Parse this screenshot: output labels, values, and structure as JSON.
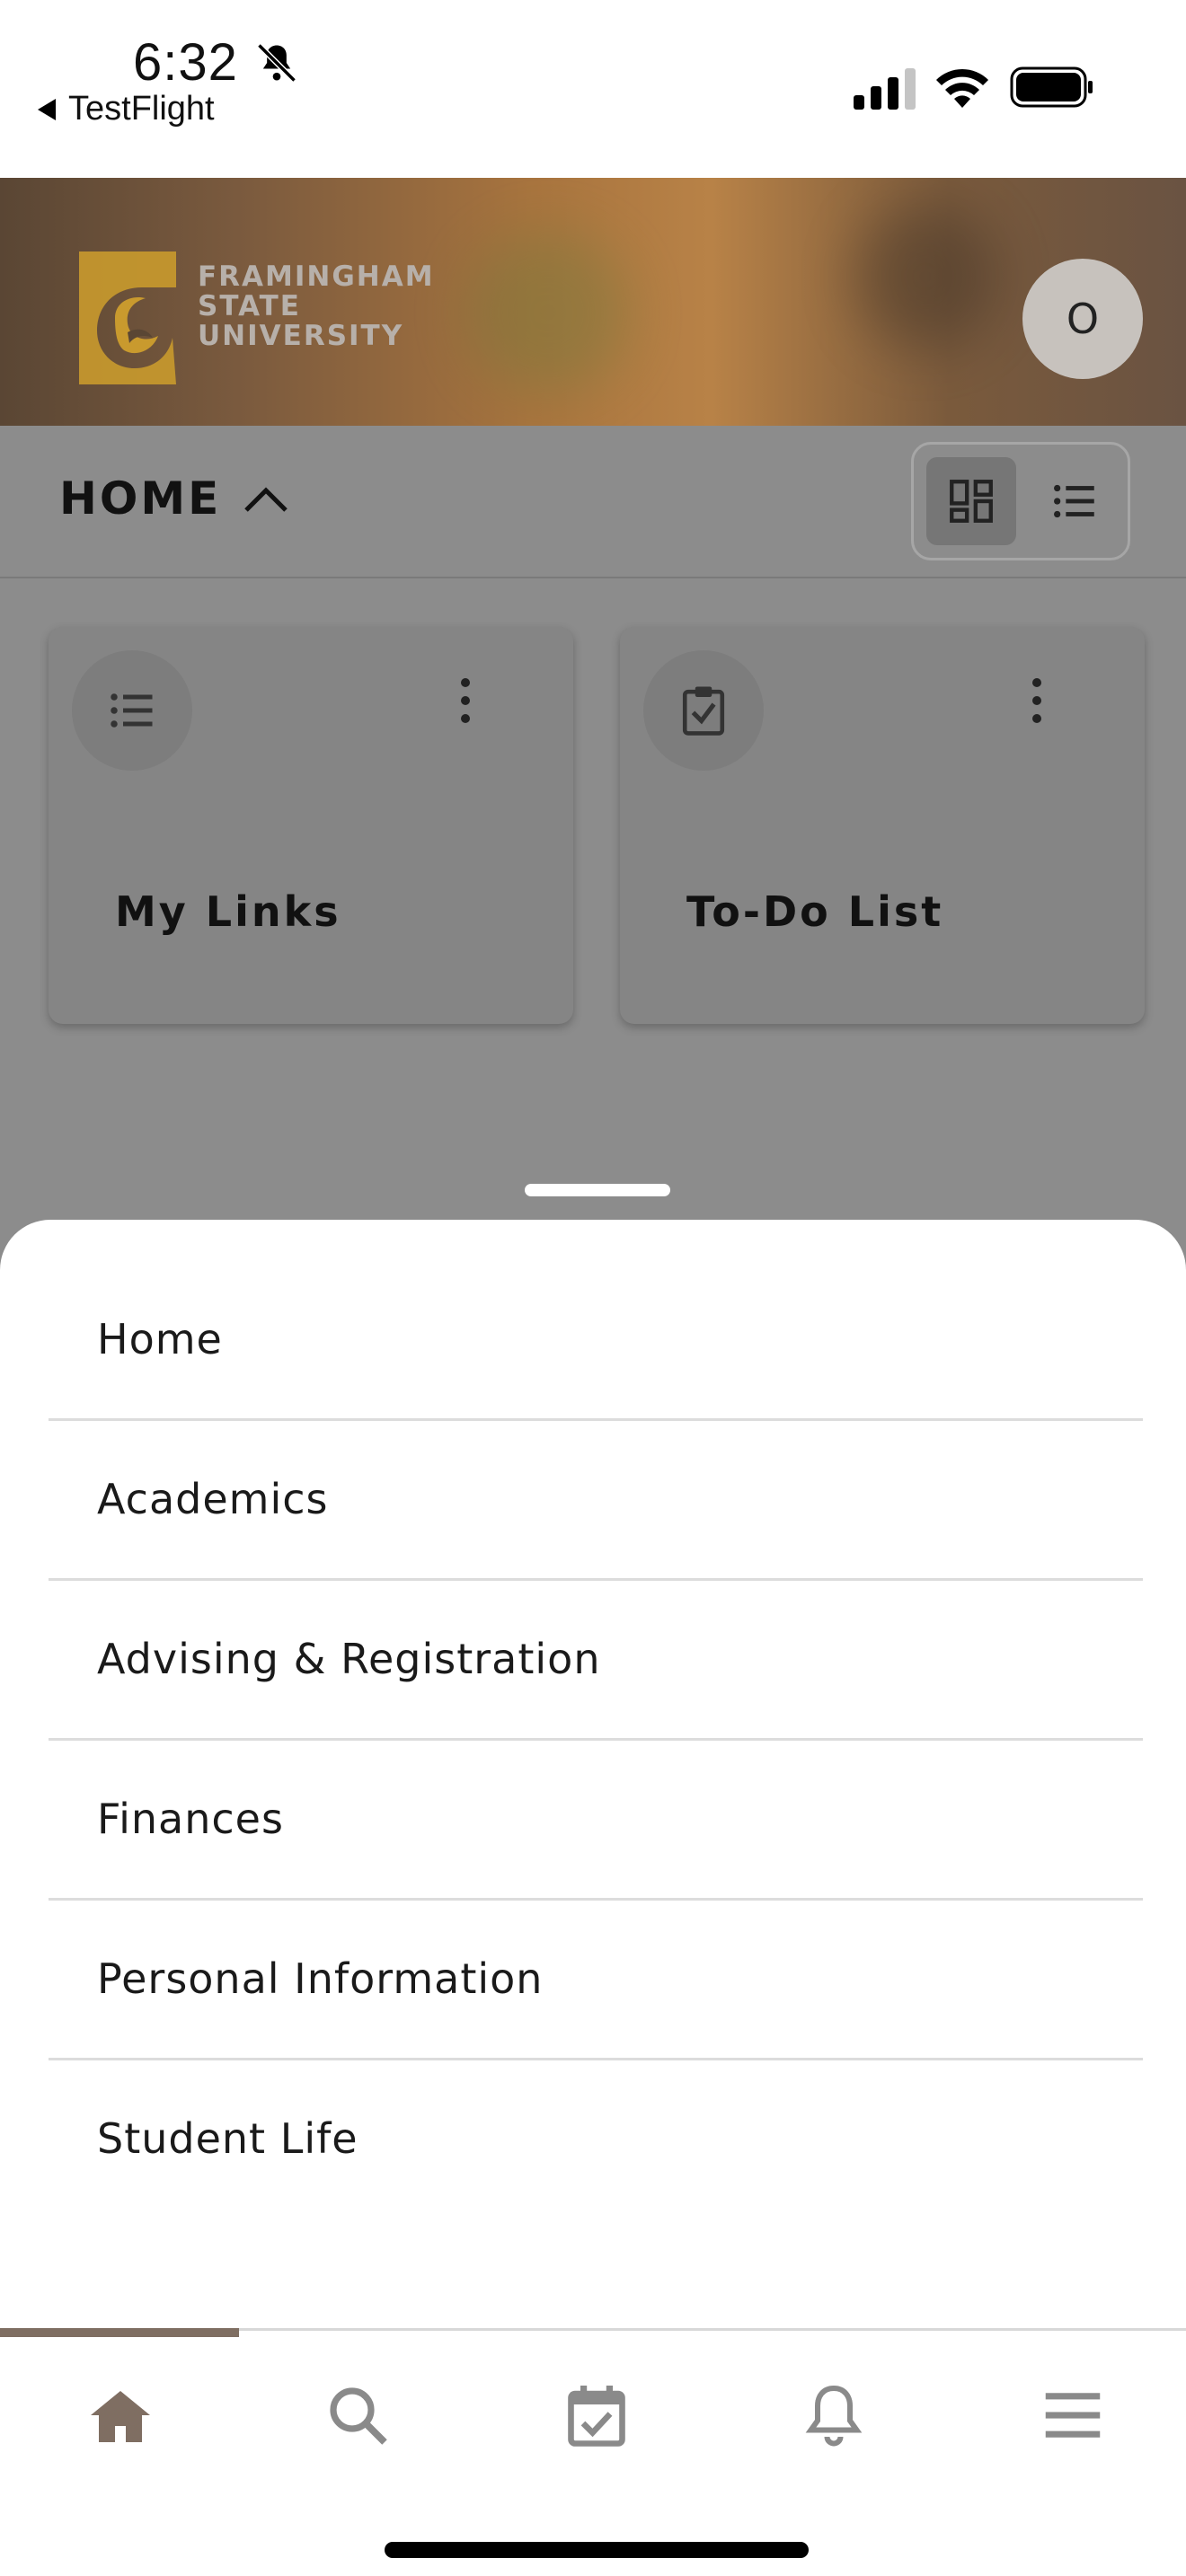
{
  "status_bar": {
    "time": "6:32",
    "back_app": "TestFlight"
  },
  "header": {
    "logo_lines": [
      "FRAMINGHAM",
      "STATE",
      "UNIVERSITY"
    ],
    "avatar_initial": "O",
    "brand_color": "#c99a2e"
  },
  "section": {
    "title": "HOME"
  },
  "cards": [
    {
      "title": "My Links",
      "icon": "list-icon"
    },
    {
      "title": "To-Do List",
      "icon": "clipboard-check-icon"
    }
  ],
  "menu": {
    "items": [
      "Home",
      "Academics",
      "Advising & Registration",
      "Finances",
      "Personal Information",
      "Student Life"
    ]
  },
  "tabbar": {
    "tabs": [
      "home-icon",
      "search-icon",
      "calendar-check-icon",
      "bell-icon",
      "menu-icon"
    ],
    "active_index": 0,
    "accent": "#7f6e62"
  }
}
